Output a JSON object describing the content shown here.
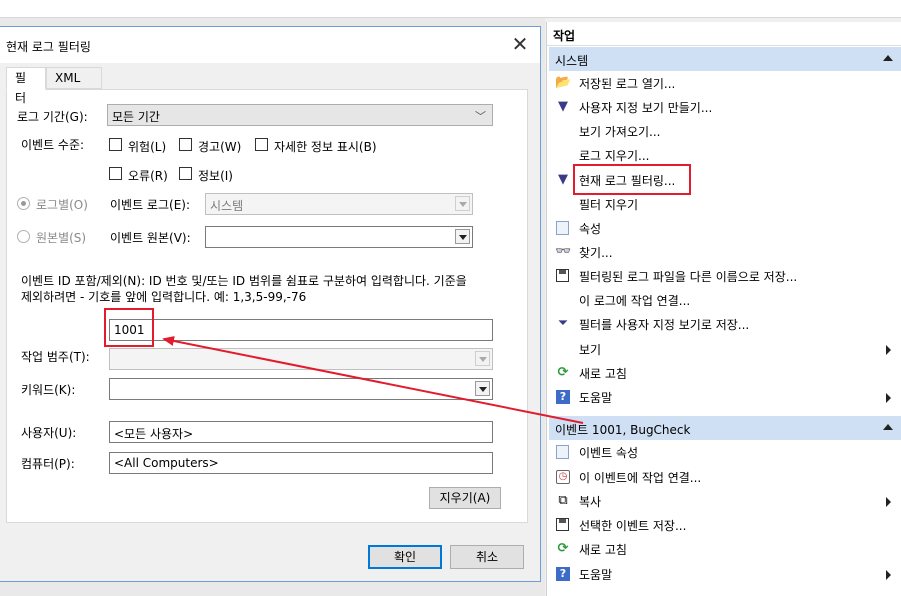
{
  "dialog": {
    "title": "현재 로그 필터링",
    "close_glyph": "✕",
    "tabs": [
      "필터",
      "XML"
    ],
    "log_period_label": "로그 기간(G):",
    "log_period_value": "모든 기간",
    "event_level_label": "이벤트 수준:",
    "levels": [
      "위험(L)",
      "경고(W)",
      "자세한 정보 표시(B)",
      "오류(R)",
      "정보(I)"
    ],
    "by_log_label": "로그별(O)",
    "event_logs_label": "이벤트 로그(E):",
    "event_logs_value": "시스템",
    "by_source_label": "원본별(S)",
    "event_sources_label": "이벤트 원본(V):",
    "event_sources_value": "",
    "id_help_line1": "이벤트 ID 포함/제외(N): ID 번호 및/또는 ID 범위를 쉼표로 구분하여 입력합니다. 기준을",
    "id_help_line2": "제외하려면 - 기호를 앞에 입력합니다. 예: 1,3,5-99,-76",
    "event_id_value": "1001",
    "task_category_label": "작업 범주(T):",
    "keywords_label": "키워드(K):",
    "user_label": "사용자(U):",
    "user_value": "<모든 사용자>",
    "computer_label": "컴퓨터(P):",
    "computer_value": "<All Computers>",
    "clear_button": "지우기(A)",
    "ok_button": "확인",
    "cancel_button": "취소"
  },
  "actions": {
    "title": "작업",
    "section_system": "시스템",
    "system_items": [
      {
        "label": "저장된 로그 열기...",
        "icon": "folder-icon"
      },
      {
        "label": "사용자 지정 보기 만들기...",
        "icon": "filter-icon"
      },
      {
        "label": "보기 가져오기...",
        "icon": ""
      },
      {
        "label": "로그 지우기...",
        "icon": ""
      },
      {
        "label": "현재 로그 필터링...",
        "icon": "filter-icon"
      },
      {
        "label": "필터 지우기",
        "icon": ""
      },
      {
        "label": "속성",
        "icon": "properties-icon"
      },
      {
        "label": "찾기...",
        "icon": "binoculars-icon"
      },
      {
        "label": "필터링된 로그 파일을 다른 이름으로 저장...",
        "icon": "save-icon"
      },
      {
        "label": "이 로그에 작업 연결...",
        "icon": ""
      },
      {
        "label": "필터를 사용자 지정 보기로 저장...",
        "icon": "filter-save-icon"
      },
      {
        "label": "보기",
        "icon": ""
      },
      {
        "label": "새로 고침",
        "icon": "refresh-icon"
      },
      {
        "label": "도움말",
        "icon": "help-icon"
      }
    ],
    "section_event": "이벤트 1001, BugCheck",
    "event_items": [
      {
        "label": "이벤트 속성",
        "icon": "properties-icon"
      },
      {
        "label": "이 이벤트에 작업 연결...",
        "icon": "task-icon"
      },
      {
        "label": "복사",
        "icon": "copy-icon"
      },
      {
        "label": "선택한 이벤트 저장...",
        "icon": "save-icon"
      },
      {
        "label": "새로 고침",
        "icon": "refresh-icon"
      },
      {
        "label": "도움말",
        "icon": "help-icon"
      }
    ]
  },
  "colors": {
    "highlight_red": "#e21b2d",
    "section_blue": "#cfe0f4",
    "primary_border": "#0078d7"
  }
}
